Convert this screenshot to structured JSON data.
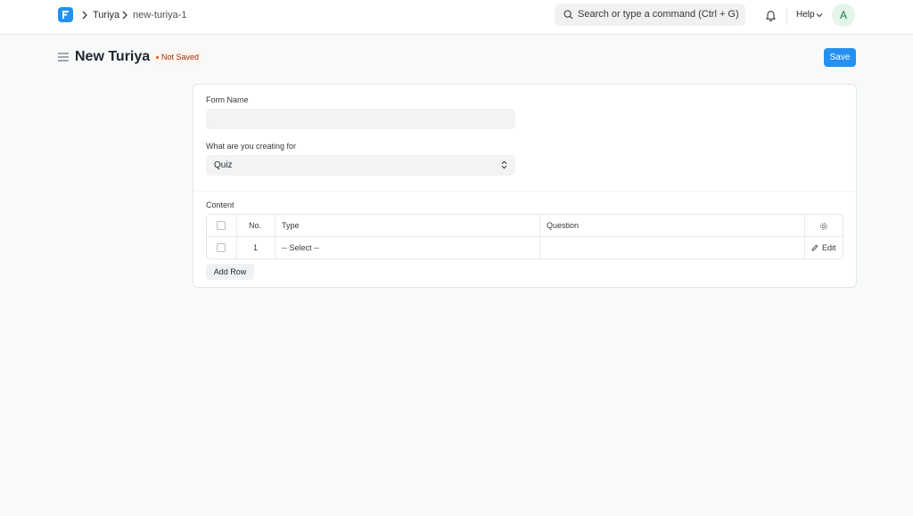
{
  "navbar": {
    "breadcrumbs": [
      "Turiya",
      "new-turiya-1"
    ],
    "search_placeholder": "Search or type a command (Ctrl + G)",
    "help_label": "Help",
    "avatar_initial": "A"
  },
  "page": {
    "title": "New Turiya",
    "status": "Not Saved",
    "save_label": "Save"
  },
  "form": {
    "form_name_label": "Form Name",
    "form_name_value": "",
    "creating_for_label": "What are you creating for",
    "creating_for_value": "Quiz",
    "content_label": "Content"
  },
  "table": {
    "headers": [
      "No.",
      "Type",
      "Question"
    ],
    "rows": [
      {
        "no": "1",
        "type": "-- Select --",
        "question": "",
        "edit_label": "Edit"
      }
    ],
    "add_row_label": "Add Row"
  },
  "colors": {
    "primary": "#2490ef",
    "status_bg": "#fff5f0",
    "status_text": "#9c2d05",
    "avatar_bg": "#e4f5e9",
    "avatar_text": "#16794c"
  }
}
